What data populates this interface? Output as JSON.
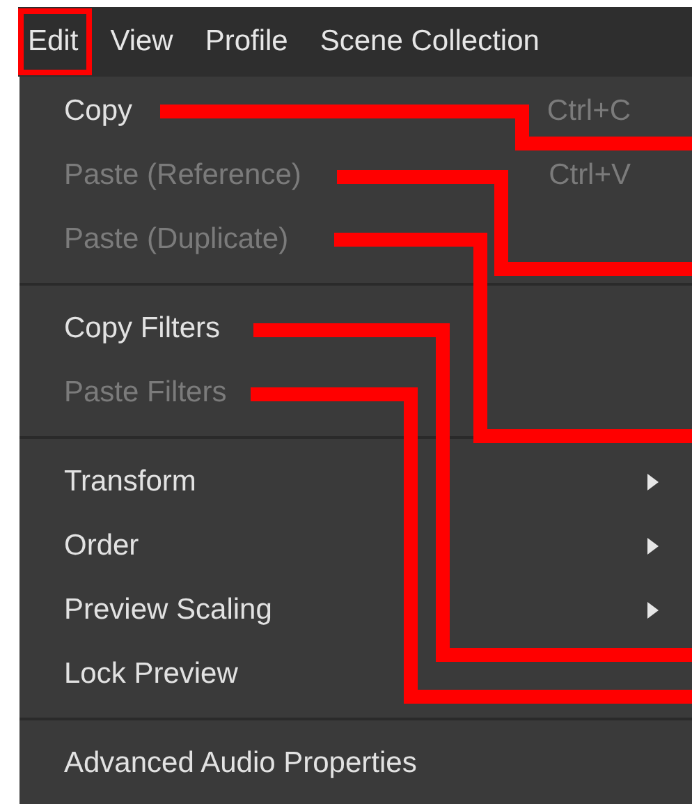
{
  "menubar": [
    {
      "label": "Edit",
      "selected": true
    },
    {
      "label": "View",
      "selected": false
    },
    {
      "label": "Profile",
      "selected": false
    },
    {
      "label": "Scene Collection",
      "selected": false
    }
  ],
  "menu": [
    {
      "kind": "item",
      "label": "Copy",
      "shortcut": "Ctrl+C",
      "disabled": false,
      "submenu": false
    },
    {
      "kind": "item",
      "label": "Paste (Reference)",
      "shortcut": "Ctrl+V",
      "disabled": true,
      "submenu": false
    },
    {
      "kind": "item",
      "label": "Paste (Duplicate)",
      "disabled": true,
      "submenu": false
    },
    {
      "kind": "separator"
    },
    {
      "kind": "item",
      "label": "Copy Filters",
      "disabled": false,
      "submenu": false
    },
    {
      "kind": "item",
      "label": "Paste Filters",
      "disabled": true,
      "submenu": false
    },
    {
      "kind": "separator"
    },
    {
      "kind": "item",
      "label": "Transform",
      "disabled": false,
      "submenu": true
    },
    {
      "kind": "item",
      "label": "Order",
      "disabled": false,
      "submenu": true
    },
    {
      "kind": "item",
      "label": "Preview Scaling",
      "disabled": false,
      "submenu": true
    },
    {
      "kind": "item",
      "label": "Lock Preview",
      "disabled": false,
      "submenu": false
    },
    {
      "kind": "separator"
    },
    {
      "kind": "item",
      "label": "Advanced Audio Properties",
      "disabled": false,
      "submenu": false
    }
  ]
}
